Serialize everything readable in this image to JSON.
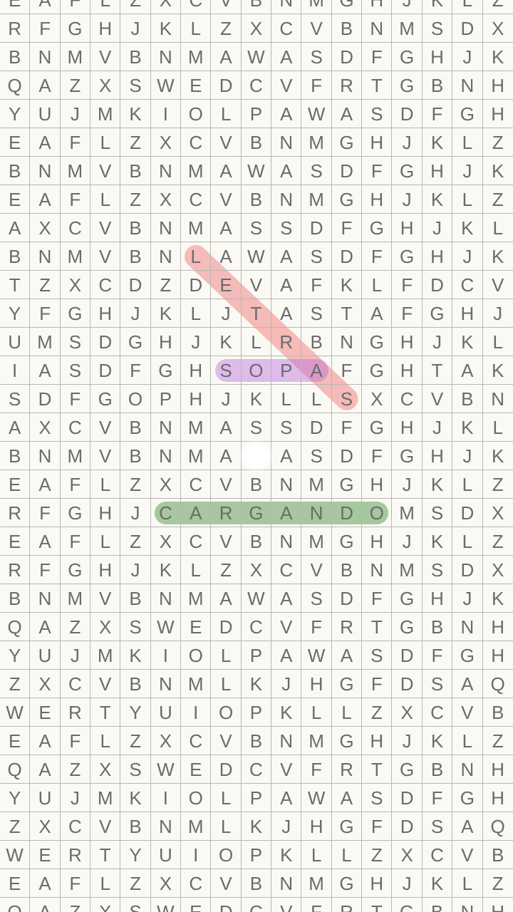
{
  "grid": {
    "rows": [
      "EAFLZXCVBNMGHJKLZ",
      "RFGHJKLZXCVBNMSDX",
      "BNMVBNMAWASDFGHJK",
      "QAZXSWEDCVFRTGBNH",
      "YUJMKIOLPAWASDFGH",
      "EAFLZXCVBNMGHJKLZ",
      "BNMVBNMAWASDFGHJK",
      "EAFLZXCVBNMGHJKLZ",
      "AXCVBNMASSDFGHJKL",
      "BNMVBNLAWASDFGHJK",
      "TZXCDZDEVAFKLFDCV",
      "YFGHJKLJTASTAFGHJ",
      "UMSDGHJKLRBNGHJKL",
      "IASDFGHSOPAFGHTAK",
      "SDFGOPHJKLLSXCVBN",
      "AXCVBNMASSDFGHJKL",
      "BNMVBNMA ASDFGHJK",
      "EAFLZXCVBNMGHJKLZ",
      "RFGHJCARGANDOMSDX",
      "EAFLZXCVBNMGHJKLZ",
      "RFGHJKLZXCVBNMSDX",
      "BNMVBNMAWASDFGHJK",
      "QAZXSWEDCVFRTGBNH",
      "YUJMKIOLPAWASDFGH",
      "ZXCVBNMLKJHGFDSAQ",
      "WERTYUIOPKLLZXCVB",
      "EAFLZXCVBNMGHJKLZ",
      "QAZXSWEDCVFRTGBNH",
      "YUJMKIOLPAWASDFGH",
      "ZXCVBNMLKJHGFDSAQ",
      "WERTYUIOPKLLZXCVB",
      "EAFLZXCVBNMGHJKLZ",
      "QAZXSWEDCVFRTGBNH"
    ]
  },
  "found_words": [
    {
      "word": "SOPA",
      "direction": "horizontal",
      "color": "#ba6ede"
    },
    {
      "word": "CARGANDO",
      "direction": "horizontal",
      "color": "#609e5a"
    },
    {
      "word": "LETRAS",
      "direction": "diagonal",
      "color": "#eb6e6e"
    }
  ],
  "colors": {
    "background": "#fbf9f4",
    "grid_line": "#b9b7b2",
    "letter": "#6b6b6b"
  }
}
